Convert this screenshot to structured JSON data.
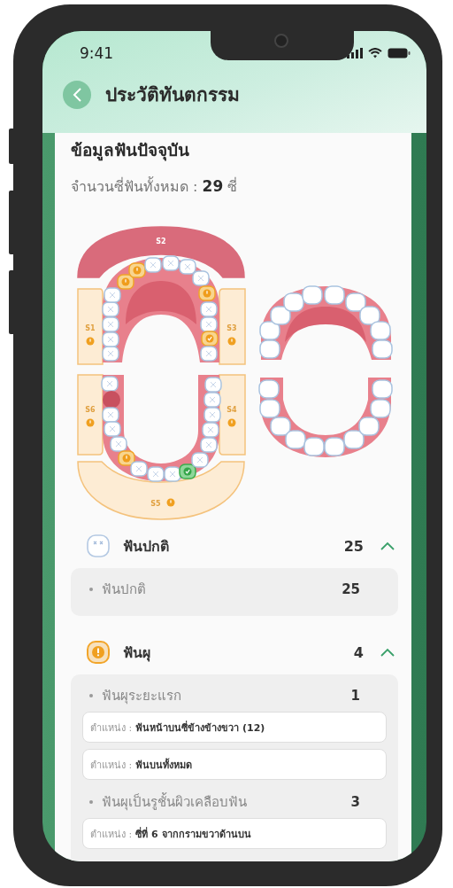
{
  "status_bar": {
    "time": "9:41"
  },
  "header": {
    "title": "ประวัติทันตกรรม"
  },
  "summary": {
    "title": "ข้อมูลฟันปัจจุบัน",
    "count_text": "จำนวนซี่ฟันทั้งหมด : **29** ซี่"
  },
  "dental_chart": {
    "sextants": [
      {
        "label": "S1",
        "kind": "warning"
      },
      {
        "label": "S2",
        "kind": "alert"
      },
      {
        "label": "S3",
        "kind": "warning"
      },
      {
        "label": "S4",
        "kind": "warning"
      },
      {
        "label": "S5",
        "kind": "warning"
      },
      {
        "label": "S6",
        "kind": "warning"
      }
    ],
    "upper_teeth": [
      {
        "kind": "normal"
      },
      {
        "kind": "normal"
      },
      {
        "kind": "normal"
      },
      {
        "kind": "normal"
      },
      {
        "kind": "normal"
      },
      {
        "kind": "caries"
      },
      {
        "kind": "caries"
      },
      {
        "kind": "normal"
      },
      {
        "kind": "normal"
      },
      {
        "kind": "normal"
      },
      {
        "kind": "normal"
      },
      {
        "kind": "caries"
      },
      {
        "kind": "normal"
      },
      {
        "kind": "normal"
      },
      {
        "kind": "filled"
      },
      {
        "kind": "normal"
      }
    ],
    "lower_teeth": [
      {
        "kind": "normal"
      },
      {
        "kind": "missing"
      },
      {
        "kind": "normal"
      },
      {
        "kind": "normal"
      },
      {
        "kind": "normal"
      },
      {
        "kind": "caries"
      },
      {
        "kind": "normal"
      },
      {
        "kind": "normal"
      },
      {
        "kind": "normal"
      },
      {
        "kind": "sealed"
      },
      {
        "kind": "normal"
      },
      {
        "kind": "normal"
      },
      {
        "kind": "normal"
      },
      {
        "kind": "normal"
      },
      {
        "kind": "normal"
      },
      {
        "kind": "normal"
      }
    ]
  },
  "categories": [
    {
      "kind": "normal",
      "title": "ฟันปกติ",
      "count": "25",
      "expanded": true,
      "groups": [
        {
          "title": "ฟันปกติ",
          "count": "25"
        }
      ]
    },
    {
      "kind": "caries",
      "title": "ฟันผุ",
      "count": "4",
      "expanded": true,
      "groups": [
        {
          "title": "ฟันผุระยะแรก",
          "count": "1",
          "positions": [
            {
              "label": "ตำแหน่ง :",
              "value": "ฟันหน้าบนซี่ข้างข้างขวา (12)"
            },
            {
              "label": "ตำแหน่ง :",
              "value": "ฟันบนทั้งหมด"
            }
          ]
        },
        {
          "title": "ฟันผุเป็นรูชั้นผิวเคลือบฟัน",
          "count": "3",
          "positions": [
            {
              "label": "ตำแหน่ง :",
              "value": "ซี่ที่ 6 จากกรามขวาด้านบน"
            }
          ]
        }
      ]
    }
  ]
}
